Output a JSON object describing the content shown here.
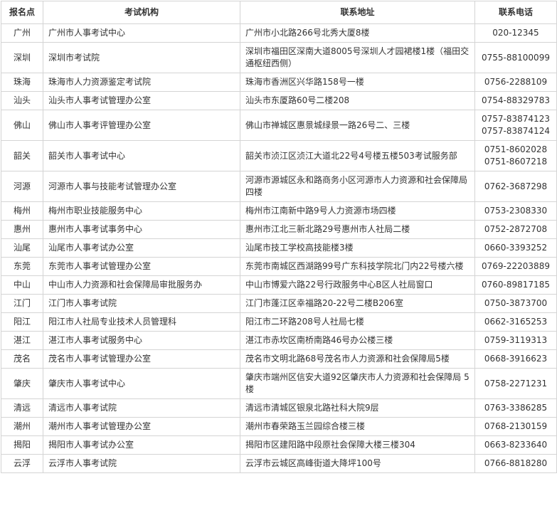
{
  "headers": [
    "报名点",
    "考试机构",
    "联系地址",
    "联系电话"
  ],
  "rows": [
    {
      "site": "广州",
      "org": "广州市人事考试中心",
      "address": "广州市小北路266号北秀大厦8楼",
      "phones": [
        "020-12345"
      ]
    },
    {
      "site": "深圳",
      "org": "深圳市考试院",
      "address": "深圳市福田区深南大道8005号深圳人才园裙楼1楼（福田交通枢纽西侧）",
      "phones": [
        "0755-88100099"
      ]
    },
    {
      "site": "珠海",
      "org": "珠海市人力资源鉴定考试院",
      "address": "珠海市香洲区兴华路158号一楼",
      "phones": [
        "0756-2288109"
      ]
    },
    {
      "site": "汕头",
      "org": "汕头市人事考试管理办公室",
      "address": "汕头市东厦路60号二楼208",
      "phones": [
        "0754-88329783"
      ]
    },
    {
      "site": "佛山",
      "org": "佛山市人事考评管理办公室",
      "address": "佛山市禅城区惠景城绿景一路26号二、三楼",
      "phones": [
        "0757-83874123",
        "0757-83874124"
      ]
    },
    {
      "site": "韶关",
      "org": "韶关市人事考试中心",
      "address": "韶关市浈江区浈江大道北22号4号楼五楼503考试服务部",
      "phones": [
        "0751-8602028",
        "0751-8607218"
      ]
    },
    {
      "site": "河源",
      "org": "河源市人事与技能考试管理办公室",
      "address": "河源市源城区永和路商务小区河源市人力资源和社会保障局四楼",
      "phones": [
        "0762-3687298"
      ]
    },
    {
      "site": "梅州",
      "org": "梅州市职业技能服务中心",
      "address": "梅州市江南新中路9号人力资源市场四楼",
      "phones": [
        "0753-2308330"
      ]
    },
    {
      "site": "惠州",
      "org": "惠州市人事考试事务中心",
      "address": "惠州市江北三新北路29号惠州市人社局二楼",
      "phones": [
        "0752-2872708"
      ]
    },
    {
      "site": "汕尾",
      "org": "汕尾市人事考试办公室",
      "address": "汕尾市技工学校高技能楼3楼",
      "phones": [
        "0660-3393252"
      ]
    },
    {
      "site": "东莞",
      "org": "东莞市人事考试管理办公室",
      "address": "东莞市南城区西湖路99号广东科技学院北门内22号楼六楼",
      "phones": [
        "0769-22203889"
      ]
    },
    {
      "site": "中山",
      "org": "中山市人力资源和社会保障局审批服务办",
      "address": "中山市博爱六路22号行政服务中心B区人社局窗口",
      "phones": [
        "0760-89817185"
      ]
    },
    {
      "site": "江门",
      "org": "江门市人事考试院",
      "address": "江门市蓬江区幸福路20-22号二楼B206室",
      "phones": [
        "0750-3873700"
      ]
    },
    {
      "site": "阳江",
      "org": "阳江市人社局专业技术人员管理科",
      "address": "阳江市二环路208号人社局七楼",
      "phones": [
        "0662-3165253"
      ]
    },
    {
      "site": "湛江",
      "org": "湛江市人事考试服务中心",
      "address": "湛江市赤坎区南桥南路46号办公楼三楼",
      "phones": [
        "0759-3119313"
      ]
    },
    {
      "site": "茂名",
      "org": "茂名市人事考试管理办公室",
      "address": "茂名市文明北路68号茂名市人力资源和社会保障局5楼",
      "phones": [
        "0668-3916623"
      ]
    },
    {
      "site": "肇庆",
      "org": "肇庆市人事考试中心",
      "address": "肇庆市端州区信安大道92区肇庆市人力资源和社会保障局 5楼",
      "phones": [
        "0758-2271231"
      ]
    },
    {
      "site": "清远",
      "org": "清远市人事考试院",
      "address": "清远市清城区银泉北路社科大院9层",
      "phones": [
        "0763-3386285"
      ]
    },
    {
      "site": "潮州",
      "org": "潮州市人事考试管理办公室",
      "address": "潮州市春荣路玉兰园综合楼三楼",
      "phones": [
        "0768-2130159"
      ]
    },
    {
      "site": "揭阳",
      "org": "揭阳市人事考试办公室",
      "address": "揭阳市区建阳路中段原社会保障大楼三楼304",
      "phones": [
        "0663-8233640"
      ]
    },
    {
      "site": "云浮",
      "org": "云浮市人事考试院",
      "address": "云浮市云城区高峰街道大降坪100号",
      "phones": [
        "0766-8818280"
      ]
    }
  ]
}
